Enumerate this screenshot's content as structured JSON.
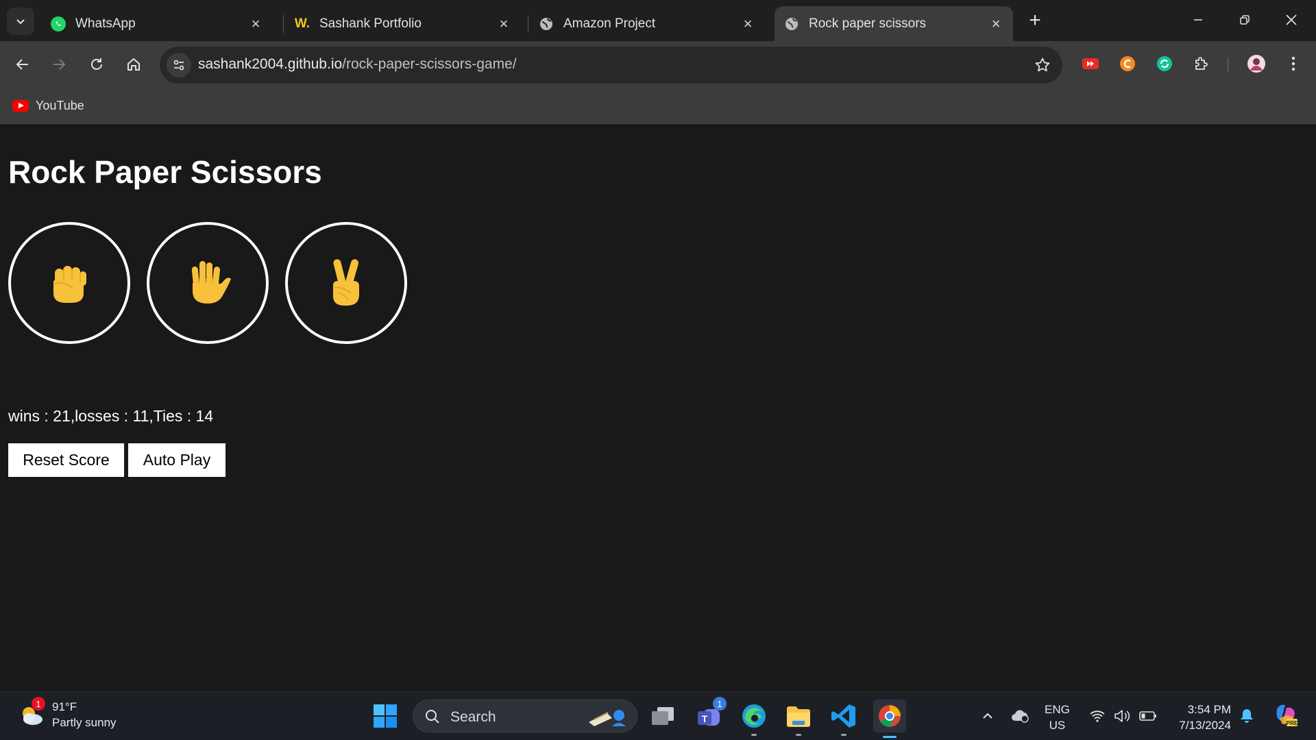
{
  "browser": {
    "tabs": [
      {
        "title": "WhatsApp",
        "icon": "whatsapp-icon",
        "active": false
      },
      {
        "title": "Sashank Portfolio",
        "icon": "w-logo-icon",
        "favicon_text": "W.",
        "active": false
      },
      {
        "title": "Amazon Project",
        "icon": "globe-icon",
        "active": false
      },
      {
        "title": "Rock paper scissors",
        "icon": "globe-icon",
        "active": true
      }
    ],
    "url": {
      "host": "sashank2004.github.io",
      "path": "/rock-paper-scissors-game/"
    },
    "bookmarks": [
      {
        "label": "YouTube",
        "icon": "youtube-icon"
      }
    ]
  },
  "page": {
    "title": "Rock Paper Scissors",
    "moves": [
      {
        "name": "rock",
        "glyph": "✊"
      },
      {
        "name": "paper",
        "glyph": "🖐"
      },
      {
        "name": "scissors",
        "glyph": "✌"
      }
    ],
    "score_text": "wins : 21,losses : 11,Ties : 14",
    "reset_label": "Reset Score",
    "autoplay_label": "Auto Play"
  },
  "taskbar": {
    "weather": {
      "temp": "91°F",
      "condition": "Partly sunny",
      "badge": "1"
    },
    "search_label": "Search",
    "teams_badge": "1",
    "language": {
      "line1": "ENG",
      "line2": "US"
    },
    "clock": {
      "time": "3:54 PM",
      "date": "7/13/2024"
    }
  },
  "colors": {
    "page_bg": "#191919",
    "tab_strip": "#1f1f1f",
    "toolbar": "#3c3c3c",
    "button_bg": "#ffffff",
    "emoji_yellow": "#f8c13a"
  }
}
